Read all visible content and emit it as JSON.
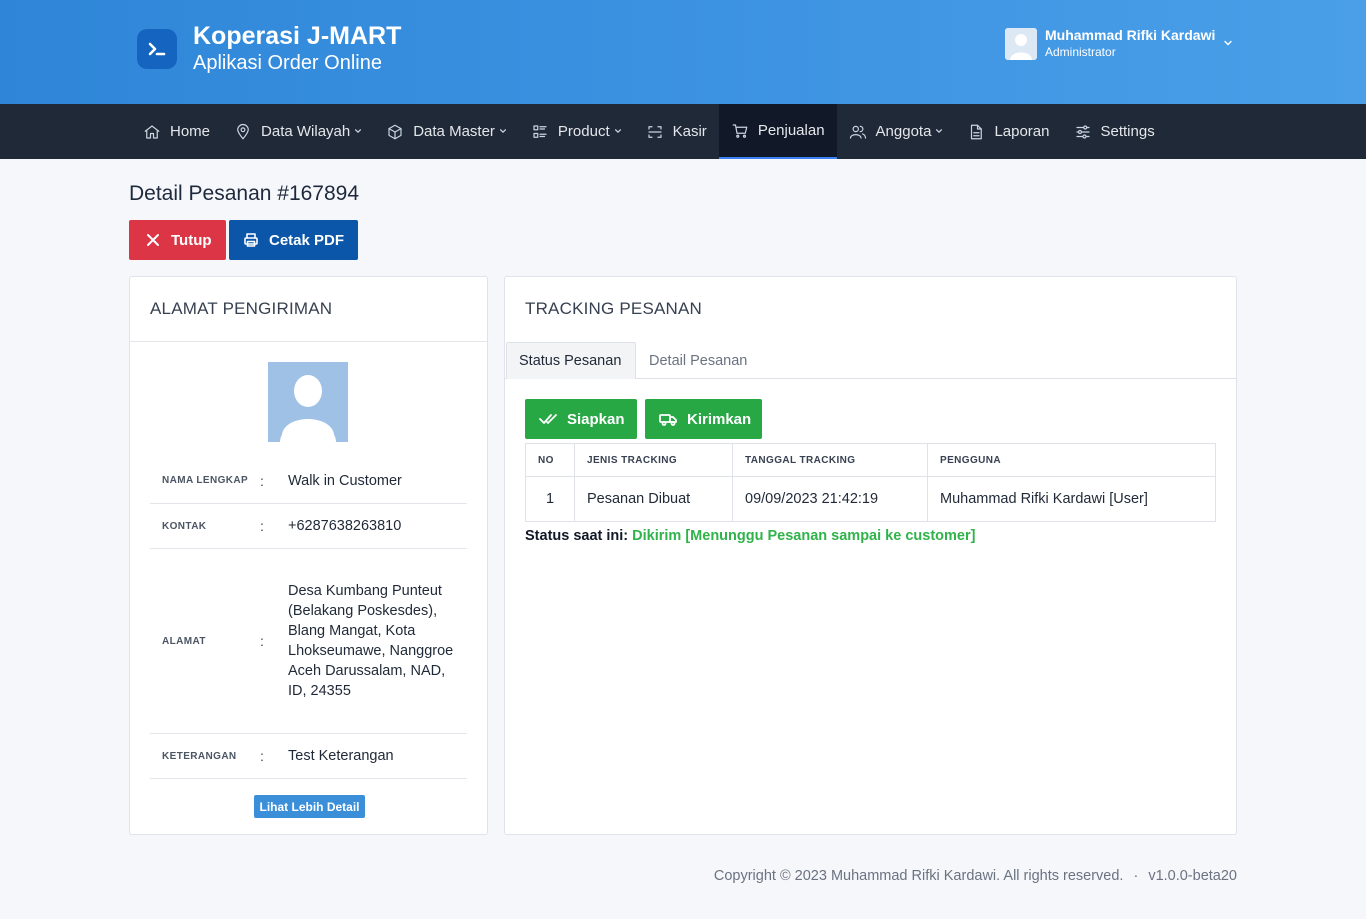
{
  "header": {
    "brand_title": "Koperasi J-MART",
    "brand_subtitle": "Aplikasi Order Online",
    "user_name": "Muhammad Rifki Kardawi",
    "user_role": "Administrator"
  },
  "nav": [
    {
      "label": "Home",
      "icon": "home-icon"
    },
    {
      "label": "Data Wilayah",
      "icon": "map-pin-icon",
      "dropdown": true
    },
    {
      "label": "Data Master",
      "icon": "box-icon",
      "dropdown": true
    },
    {
      "label": "Product",
      "icon": "list-icon",
      "dropdown": true
    },
    {
      "label": "Kasir",
      "icon": "scan-icon"
    },
    {
      "label": "Penjualan",
      "icon": "cart-icon",
      "active": true
    },
    {
      "label": "Anggota",
      "icon": "users-icon",
      "dropdown": true
    },
    {
      "label": "Laporan",
      "icon": "file-icon"
    },
    {
      "label": "Settings",
      "icon": "sliders-icon"
    }
  ],
  "page": {
    "title": "Detail Pesanan #167894",
    "close_label": "Tutup",
    "pdf_label": "Cetak PDF"
  },
  "shipping": {
    "heading": "ALAMAT PENGIRIMAN",
    "rows": [
      {
        "label": "NAMA LENGKAP",
        "value": "Walk in Customer"
      },
      {
        "label": "KONTAK",
        "value": "+6287638263810"
      },
      {
        "label": "ALAMAT",
        "value": "Desa Kumbang Punteut (Belakang Poskesdes), Blang Mangat, Kota Lhokseumawe, Nanggroe Aceh Darussalam, NAD, ID, 24355"
      },
      {
        "label": "KETERANGAN",
        "value": "Test Keterangan"
      }
    ],
    "colon": ":",
    "more_label": "Lihat Lebih Detail"
  },
  "tracking": {
    "heading": "TRACKING PESANAN",
    "tabs": [
      "Status Pesanan",
      "Detail Pesanan"
    ],
    "btn_prepare": "Siapkan",
    "btn_ship": "Kirimkan",
    "columns": [
      "NO",
      "JENIS TRACKING",
      "TANGGAL TRACKING",
      "PENGGUNA"
    ],
    "rows": [
      {
        "no": "1",
        "type": "Pesanan Dibuat",
        "date": "09/09/2023 21:42:19",
        "user": "Muhammad Rifki Kardawi [User]"
      }
    ],
    "status_label": "Status saat ini:",
    "status_value": "Dikirim [Menunggu Pesanan sampai ke customer]",
    "status_color": "#2fb34a"
  },
  "footer": {
    "copyright": "Copyright © 2023 Muhammad Rifki Kardawi. All rights reserved.",
    "separator": "·",
    "version": "v1.0.0-beta20"
  }
}
